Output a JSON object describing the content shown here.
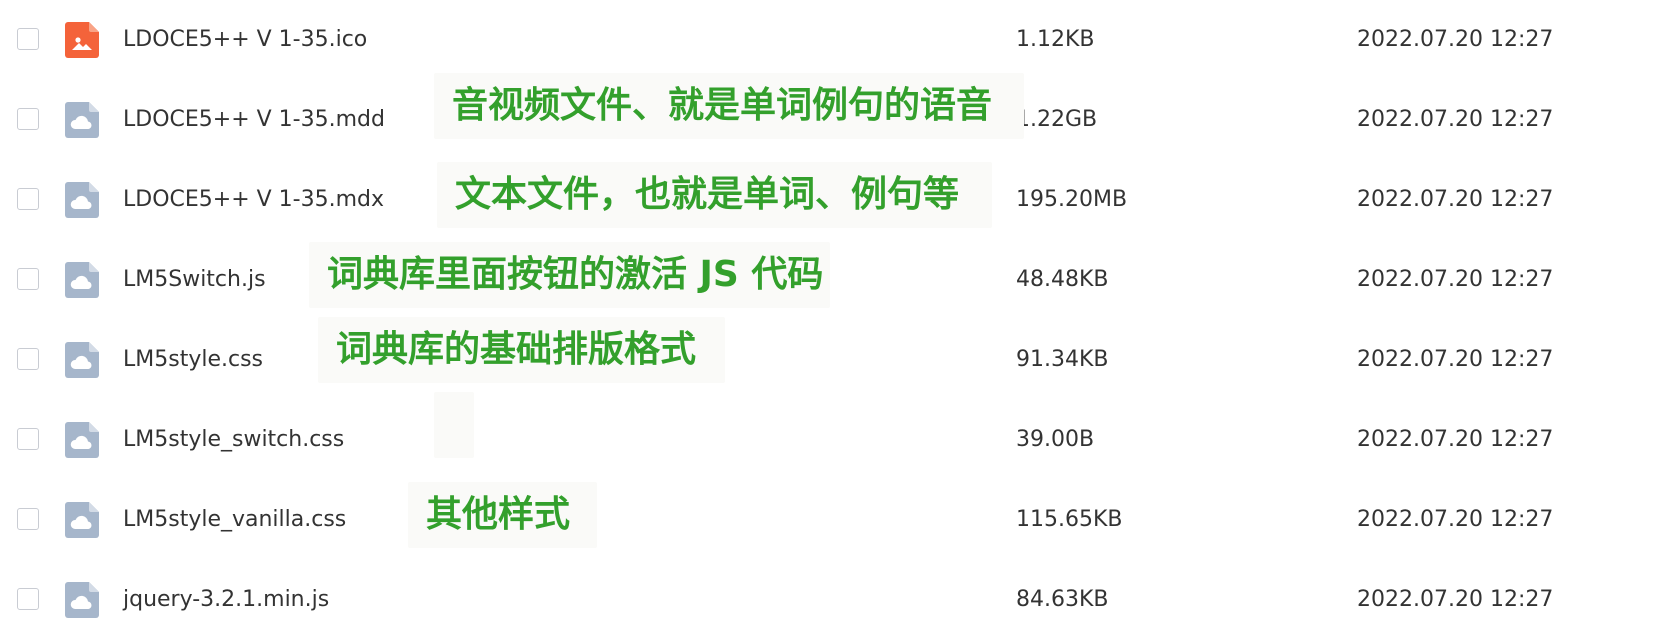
{
  "files": [
    {
      "name": "LDOCE5++ V 1-35.ico",
      "size": "1.12KB",
      "date": "2022.07.20 12:27",
      "icon": "image-file-icon",
      "icon_color": "#f4633a"
    },
    {
      "name": "LDOCE5++ V 1-35.mdd",
      "size": "1.22GB",
      "date": "2022.07.20 12:27",
      "icon": "cloud-file-icon",
      "icon_color": "#a6b6cb"
    },
    {
      "name": "LDOCE5++ V 1-35.mdx",
      "size": "195.20MB",
      "date": "2022.07.20 12:27",
      "icon": "cloud-file-icon",
      "icon_color": "#a6b6cb"
    },
    {
      "name": "LM5Switch.js",
      "size": "48.48KB",
      "date": "2022.07.20 12:27",
      "icon": "cloud-file-icon",
      "icon_color": "#a6b6cb"
    },
    {
      "name": "LM5style.css",
      "size": "91.34KB",
      "date": "2022.07.20 12:27",
      "icon": "cloud-file-icon",
      "icon_color": "#a6b6cb"
    },
    {
      "name": "LM5style_switch.css",
      "size": "39.00B",
      "date": "2022.07.20 12:27",
      "icon": "cloud-file-icon",
      "icon_color": "#a6b6cb"
    },
    {
      "name": "LM5style_vanilla.css",
      "size": "115.65KB",
      "date": "2022.07.20 12:27",
      "icon": "cloud-file-icon",
      "icon_color": "#a6b6cb"
    },
    {
      "name": "jquery-3.2.1.min.js",
      "size": "84.63KB",
      "date": "2022.07.20 12:27",
      "icon": "cloud-file-icon",
      "icon_color": "#a6b6cb"
    }
  ],
  "annotations": [
    "音视频文件、就是单词例句的语音",
    "文本文件，也就是单词、例句等",
    "词典库里面按钮的激活 JS 代码",
    "词典库的基础排版格式",
    "",
    "其他样式"
  ],
  "colors": {
    "annotation_text": "#33a02c",
    "annotation_bg": "#fafaf8",
    "text": "#333333"
  }
}
